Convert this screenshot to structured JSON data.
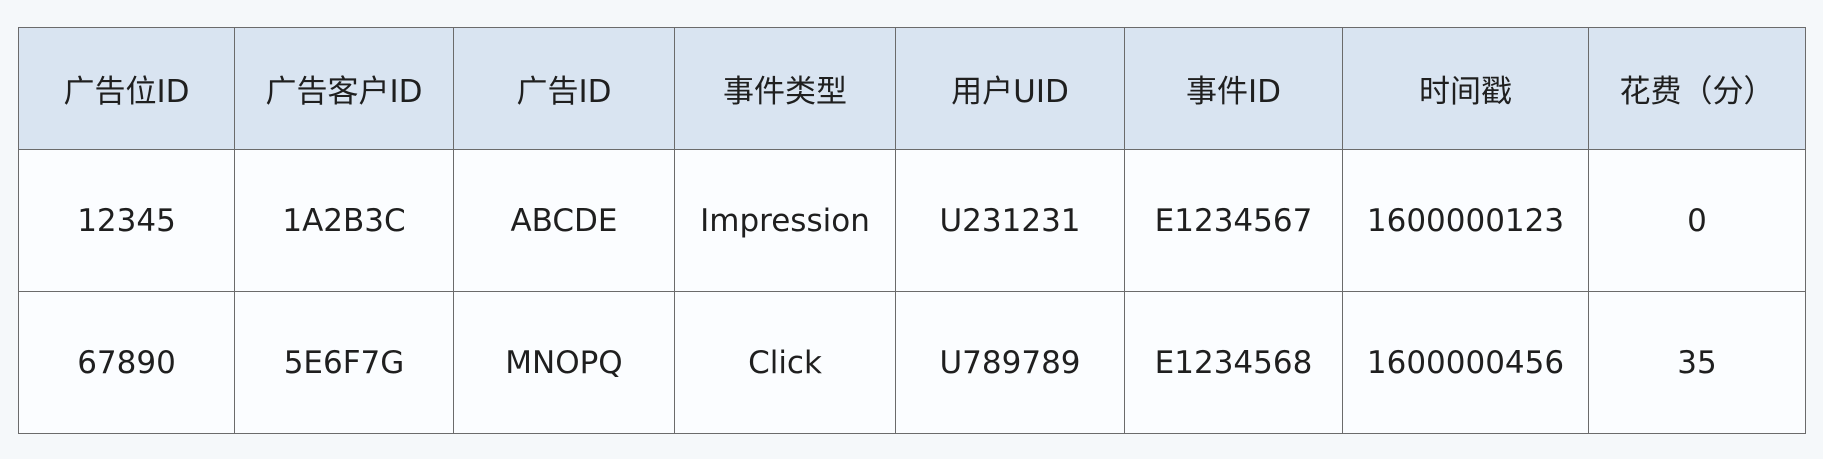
{
  "table": {
    "headers": [
      "广告位ID",
      "广告客户ID",
      "广告ID",
      "事件类型",
      "用户UID",
      "事件ID",
      "时间戳",
      "花费（分）"
    ],
    "rows": [
      [
        "12345",
        "1A2B3C",
        "ABCDE",
        "Impression",
        "U231231",
        "E1234567",
        "1600000123",
        "0"
      ],
      [
        "67890",
        "5E6F7G",
        "MNOPQ",
        "Click",
        "U789789",
        "E1234568",
        "1600000456",
        "35"
      ]
    ]
  },
  "colors": {
    "header_bg": "#d9e4f1",
    "cell_bg": "#fbfdff",
    "border": "#6b6b6b",
    "page_bg": "#f5f8fa"
  }
}
